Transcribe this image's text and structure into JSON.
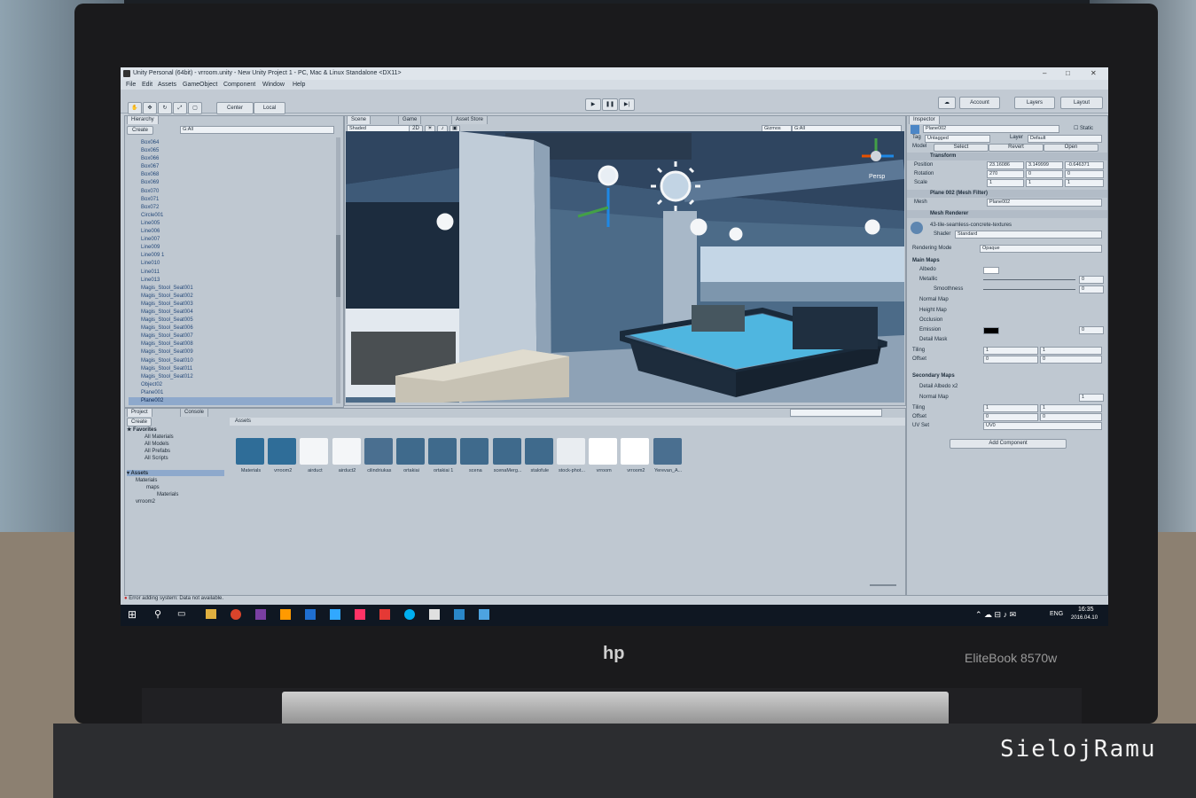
{
  "window": {
    "title": "Unity Personal (64bit) - vrroom.unity - New Unity Project 1 - PC, Mac & Linux Standalone <DX11>"
  },
  "menu": [
    "File",
    "Edit",
    "Assets",
    "GameObject",
    "Component",
    "Window",
    "Help"
  ],
  "toolbar": {
    "center_label": "Center",
    "local_label": "Local",
    "account_label": "Account",
    "layers_label": "Layers",
    "layout_label": "Layout"
  },
  "hierarchy": {
    "tab": "Hierarchy",
    "create_label": "Create",
    "search_placeholder": "G:All",
    "items": [
      "Box064",
      "Box065",
      "Box066",
      "Box067",
      "Box068",
      "Box069",
      "Box070",
      "Box071",
      "Box072",
      "Circle001",
      "Line005",
      "Line006",
      "Line007",
      "Line009",
      "Line009 1",
      "Line010",
      "Line011",
      "Line013",
      "Magis_Stool_Seat001",
      "Magis_Stool_Seat002",
      "Magis_Stool_Seat003",
      "Magis_Stool_Seat004",
      "Magis_Stool_Seat005",
      "Magis_Stool_Seat006",
      "Magis_Stool_Seat007",
      "Magis_Stool_Seat008",
      "Magis_Stool_Seat009",
      "Magis_Stool_Seat010",
      "Magis_Stool_Seat011",
      "Magis_Stool_Seat012",
      "Object02",
      "Plane001",
      "Plane002"
    ],
    "selected": "Plane002"
  },
  "scene": {
    "tabs": [
      "Scene",
      "Game",
      "Asset Store"
    ],
    "shading": "Shaded",
    "mode_2d": "2D",
    "gizmos_label": "Gizmos",
    "search_placeholder": "G:All",
    "persp_label": "Persp",
    "axis_labels": [
      "y",
      "x",
      "z"
    ]
  },
  "project": {
    "tabs": [
      "Project",
      "Console"
    ],
    "create_label": "Create",
    "favorites_label": "Favorites",
    "favorites": [
      "All Materials",
      "All Models",
      "All Prefabs",
      "All Scripts"
    ],
    "assets_label": "Assets",
    "tree": [
      "Materials",
      "maps",
      "Materials",
      "vrroom2"
    ],
    "breadcrumb": "Assets",
    "assets": [
      "Materials",
      "vrroom2",
      "airduct",
      "airduct2",
      "cilindriukas",
      "ortakiai",
      "ortakiai 1",
      "scena",
      "scenaMerg...",
      "stalofule",
      "stock-phot...",
      "vrroom",
      "vrroom2",
      "Yerevan_A..."
    ]
  },
  "status": {
    "error_text": "Error adding system: Data not available."
  },
  "inspector": {
    "tab": "Inspector",
    "object_name": "Plane002",
    "static_label": "Static",
    "tag_label": "Tag",
    "tag_value": "Untagged",
    "layer_label": "Layer",
    "layer_value": "Default",
    "model_label": "Model",
    "model_buttons": [
      "Select",
      "Revert",
      "Open"
    ],
    "transform": {
      "title": "Transform",
      "position_label": "Position",
      "position": [
        "23.16086",
        "3.149999",
        "-0.646371"
      ],
      "rotation_label": "Rotation",
      "rotation": [
        "270",
        "0",
        "0"
      ],
      "scale_label": "Scale",
      "scale": [
        "1",
        "1",
        "1"
      ]
    },
    "mesh_filter": {
      "title": "Plane 002 (Mesh Filter)",
      "mesh_label": "Mesh",
      "mesh_value": "Plane002"
    },
    "mesh_renderer": {
      "title": "Mesh Renderer"
    },
    "material": {
      "name": "43-tile-seamless-concrete-textures",
      "shader_label": "Shader",
      "shader_value": "Standard",
      "rendering_mode_label": "Rendering Mode",
      "rendering_mode_value": "Opaque",
      "main_maps_label": "Main Maps",
      "albedo_label": "Albedo",
      "metallic_label": "Metallic",
      "metallic_value": "0",
      "smoothness_label": "Smoothness",
      "smoothness_value": "0",
      "normal_map_label": "Normal Map",
      "height_map_label": "Height Map",
      "occlusion_label": "Occlusion",
      "emission_label": "Emission",
      "emission_value": "0",
      "detail_mask_label": "Detail Mask",
      "tiling_label": "Tiling",
      "tiling": [
        "1",
        "1"
      ],
      "offset_label": "Offset",
      "offset": [
        "0",
        "0"
      ],
      "secondary_maps_label": "Secondary Maps",
      "detail_albedo_label": "Detail Albedo x2",
      "normal_map2_label": "Normal Map",
      "normal_map2_value": "1",
      "tiling2": [
        "1",
        "1"
      ],
      "offset2": [
        "0",
        "0"
      ],
      "uv_set_label": "UV Set",
      "uv_set_value": "UV0"
    },
    "add_component_label": "Add Component"
  },
  "taskbar": {
    "language": "ENG",
    "time": "16:35",
    "date": "2016.04.10"
  },
  "laptop": {
    "brand": "hp",
    "model": "EliteBook 8570w"
  },
  "watermark": "SielojRamu",
  "colors": {
    "accent": "#1ea4d8",
    "selection": "#8ea9cc"
  }
}
